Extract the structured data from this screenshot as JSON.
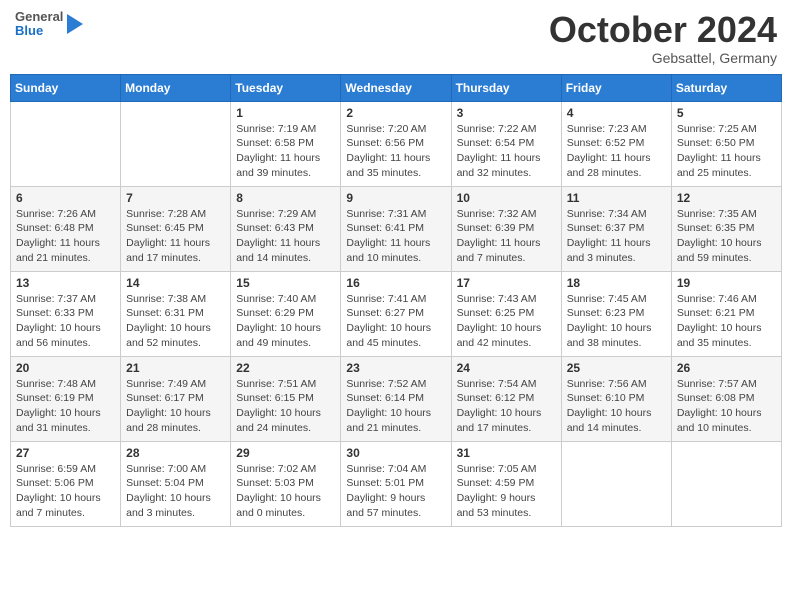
{
  "header": {
    "logo": {
      "general": "General",
      "blue": "Blue"
    },
    "title": "October 2024",
    "location": "Gebsattel, Germany"
  },
  "weekdays": [
    "Sunday",
    "Monday",
    "Tuesday",
    "Wednesday",
    "Thursday",
    "Friday",
    "Saturday"
  ],
  "weeks": [
    [
      {
        "day": "",
        "info": ""
      },
      {
        "day": "",
        "info": ""
      },
      {
        "day": "1",
        "info": "Sunrise: 7:19 AM\nSunset: 6:58 PM\nDaylight: 11 hours and 39 minutes."
      },
      {
        "day": "2",
        "info": "Sunrise: 7:20 AM\nSunset: 6:56 PM\nDaylight: 11 hours and 35 minutes."
      },
      {
        "day": "3",
        "info": "Sunrise: 7:22 AM\nSunset: 6:54 PM\nDaylight: 11 hours and 32 minutes."
      },
      {
        "day": "4",
        "info": "Sunrise: 7:23 AM\nSunset: 6:52 PM\nDaylight: 11 hours and 28 minutes."
      },
      {
        "day": "5",
        "info": "Sunrise: 7:25 AM\nSunset: 6:50 PM\nDaylight: 11 hours and 25 minutes."
      }
    ],
    [
      {
        "day": "6",
        "info": "Sunrise: 7:26 AM\nSunset: 6:48 PM\nDaylight: 11 hours and 21 minutes."
      },
      {
        "day": "7",
        "info": "Sunrise: 7:28 AM\nSunset: 6:45 PM\nDaylight: 11 hours and 17 minutes."
      },
      {
        "day": "8",
        "info": "Sunrise: 7:29 AM\nSunset: 6:43 PM\nDaylight: 11 hours and 14 minutes."
      },
      {
        "day": "9",
        "info": "Sunrise: 7:31 AM\nSunset: 6:41 PM\nDaylight: 11 hours and 10 minutes."
      },
      {
        "day": "10",
        "info": "Sunrise: 7:32 AM\nSunset: 6:39 PM\nDaylight: 11 hours and 7 minutes."
      },
      {
        "day": "11",
        "info": "Sunrise: 7:34 AM\nSunset: 6:37 PM\nDaylight: 11 hours and 3 minutes."
      },
      {
        "day": "12",
        "info": "Sunrise: 7:35 AM\nSunset: 6:35 PM\nDaylight: 10 hours and 59 minutes."
      }
    ],
    [
      {
        "day": "13",
        "info": "Sunrise: 7:37 AM\nSunset: 6:33 PM\nDaylight: 10 hours and 56 minutes."
      },
      {
        "day": "14",
        "info": "Sunrise: 7:38 AM\nSunset: 6:31 PM\nDaylight: 10 hours and 52 minutes."
      },
      {
        "day": "15",
        "info": "Sunrise: 7:40 AM\nSunset: 6:29 PM\nDaylight: 10 hours and 49 minutes."
      },
      {
        "day": "16",
        "info": "Sunrise: 7:41 AM\nSunset: 6:27 PM\nDaylight: 10 hours and 45 minutes."
      },
      {
        "day": "17",
        "info": "Sunrise: 7:43 AM\nSunset: 6:25 PM\nDaylight: 10 hours and 42 minutes."
      },
      {
        "day": "18",
        "info": "Sunrise: 7:45 AM\nSunset: 6:23 PM\nDaylight: 10 hours and 38 minutes."
      },
      {
        "day": "19",
        "info": "Sunrise: 7:46 AM\nSunset: 6:21 PM\nDaylight: 10 hours and 35 minutes."
      }
    ],
    [
      {
        "day": "20",
        "info": "Sunrise: 7:48 AM\nSunset: 6:19 PM\nDaylight: 10 hours and 31 minutes."
      },
      {
        "day": "21",
        "info": "Sunrise: 7:49 AM\nSunset: 6:17 PM\nDaylight: 10 hours and 28 minutes."
      },
      {
        "day": "22",
        "info": "Sunrise: 7:51 AM\nSunset: 6:15 PM\nDaylight: 10 hours and 24 minutes."
      },
      {
        "day": "23",
        "info": "Sunrise: 7:52 AM\nSunset: 6:14 PM\nDaylight: 10 hours and 21 minutes."
      },
      {
        "day": "24",
        "info": "Sunrise: 7:54 AM\nSunset: 6:12 PM\nDaylight: 10 hours and 17 minutes."
      },
      {
        "day": "25",
        "info": "Sunrise: 7:56 AM\nSunset: 6:10 PM\nDaylight: 10 hours and 14 minutes."
      },
      {
        "day": "26",
        "info": "Sunrise: 7:57 AM\nSunset: 6:08 PM\nDaylight: 10 hours and 10 minutes."
      }
    ],
    [
      {
        "day": "27",
        "info": "Sunrise: 6:59 AM\nSunset: 5:06 PM\nDaylight: 10 hours and 7 minutes."
      },
      {
        "day": "28",
        "info": "Sunrise: 7:00 AM\nSunset: 5:04 PM\nDaylight: 10 hours and 3 minutes."
      },
      {
        "day": "29",
        "info": "Sunrise: 7:02 AM\nSunset: 5:03 PM\nDaylight: 10 hours and 0 minutes."
      },
      {
        "day": "30",
        "info": "Sunrise: 7:04 AM\nSunset: 5:01 PM\nDaylight: 9 hours and 57 minutes."
      },
      {
        "day": "31",
        "info": "Sunrise: 7:05 AM\nSunset: 4:59 PM\nDaylight: 9 hours and 53 minutes."
      },
      {
        "day": "",
        "info": ""
      },
      {
        "day": "",
        "info": ""
      }
    ]
  ]
}
